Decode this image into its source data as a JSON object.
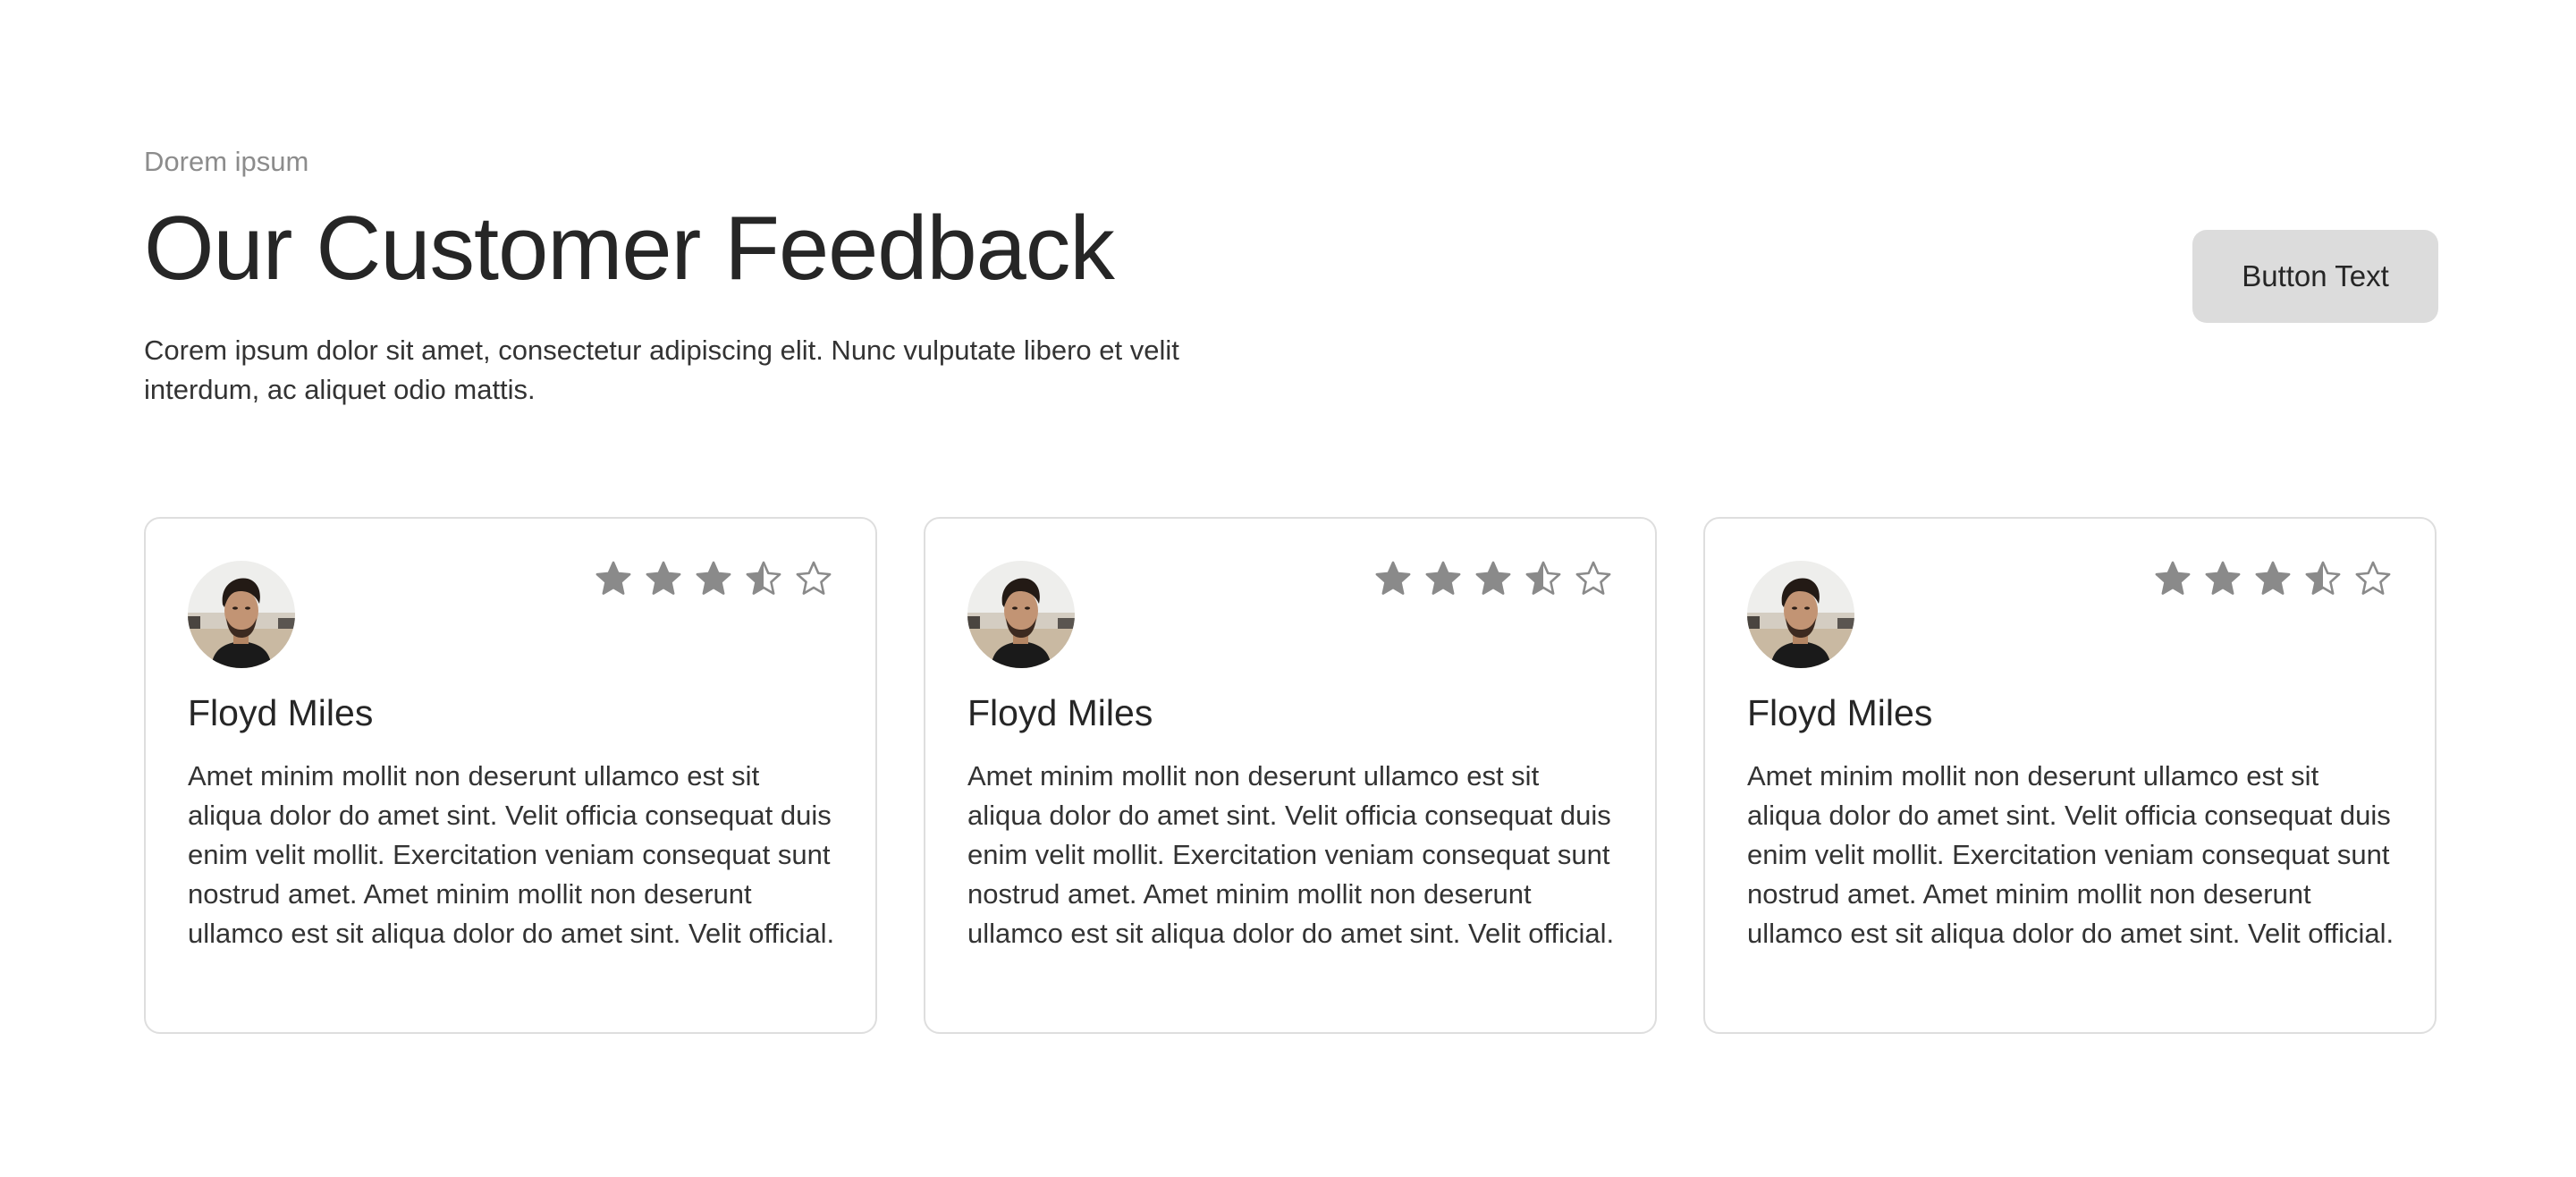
{
  "header": {
    "eyebrow": "Dorem ipsum",
    "title": "Our Customer Feedback",
    "subtitle": "Corem ipsum dolor sit amet, consectetur adipiscing elit. Nunc vulputate libero et velit interdum, ac aliquet odio mattis.",
    "button_label": "Button Text"
  },
  "colors": {
    "star": "#8a8a8a",
    "button_bg": "#dcdcdc",
    "card_border": "#dedede"
  },
  "testimonials": [
    {
      "name": "Floyd Miles",
      "rating": 3.5,
      "rating_max": 5,
      "avatar_icon": "avatar-photo",
      "text": "Amet minim mollit non deserunt ullamco est sit aliqua dolor do amet sint. Velit officia consequat duis enim velit mollit. Exercitation veniam consequat sunt nostrud amet. Amet minim mollit non deserunt ullamco est sit aliqua dolor do amet sint. Velit official."
    },
    {
      "name": "Floyd Miles",
      "rating": 3.5,
      "rating_max": 5,
      "avatar_icon": "avatar-photo",
      "text": "Amet minim mollit non deserunt ullamco est sit aliqua dolor do amet sint. Velit officia consequat duis enim velit mollit. Exercitation veniam consequat sunt nostrud amet. Amet minim mollit non deserunt ullamco est sit aliqua dolor do amet sint. Velit official."
    },
    {
      "name": "Floyd Miles",
      "rating": 3.5,
      "rating_max": 5,
      "avatar_icon": "avatar-photo",
      "text": "Amet minim mollit non deserunt ullamco est sit aliqua dolor do amet sint. Velit officia consequat duis enim velit mollit. Exercitation veniam consequat sunt nostrud amet. Amet minim mollit non deserunt ullamco est sit aliqua dolor do amet sint. Velit official."
    }
  ]
}
